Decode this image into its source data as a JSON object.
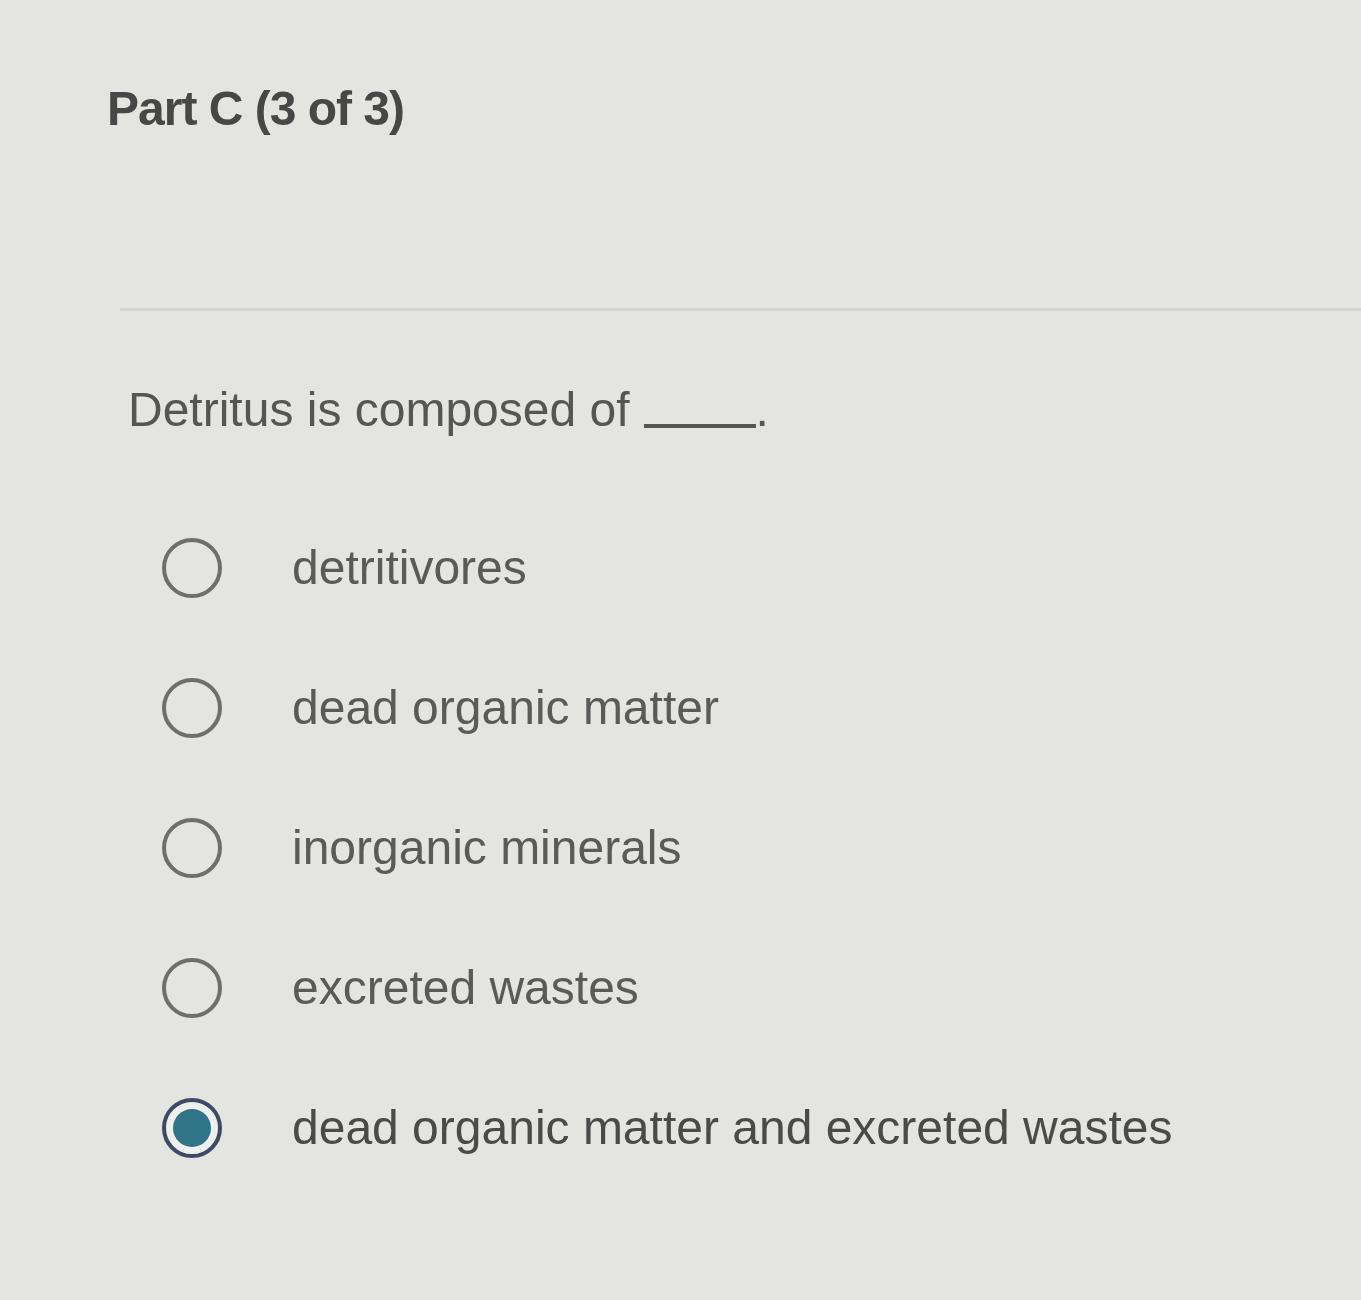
{
  "header": {
    "title": "Part C (3 of 3)"
  },
  "question": {
    "text": "Detritus is composed of",
    "after_blank": "."
  },
  "options": [
    {
      "label": "detritivores",
      "selected": false
    },
    {
      "label": "dead organic matter",
      "selected": false
    },
    {
      "label": "inorganic minerals",
      "selected": false
    },
    {
      "label": "excreted wastes",
      "selected": false
    },
    {
      "label": "dead organic matter and excreted wastes",
      "selected": true
    }
  ]
}
